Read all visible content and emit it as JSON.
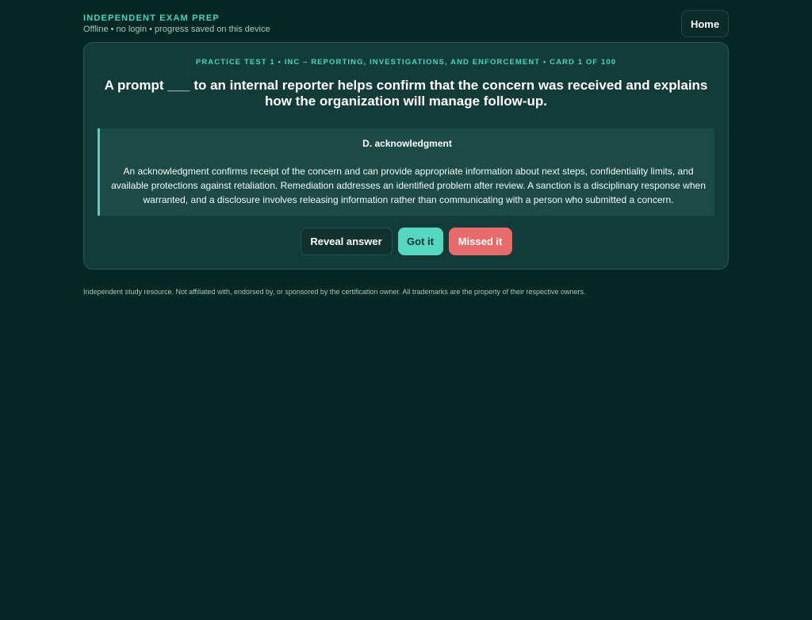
{
  "header": {
    "brand": "INDEPENDENT EXAM PREP",
    "tagline": "Offline • no login • progress saved on this device",
    "home_label": "Home"
  },
  "card": {
    "meta": "PRACTICE TEST 1 • INC – REPORTING, INVESTIGATIONS, AND ENFORCEMENT • CARD 1 OF 100",
    "question": "A prompt ___ to an internal reporter helps confirm that the concern was received and explains how the organization will manage follow-up.",
    "answer": {
      "label": "D. acknowledgment",
      "explanation": "An acknowledgment confirms receipt of the concern and can provide appropriate information about next steps, confidentiality limits, and available protections against retaliation. Remediation addresses an identified problem after review. A sanction is a disciplinary response when warranted, and a disclosure involves releasing information rather than communicating with a person who submitted a concern."
    },
    "actions": {
      "reveal_label": "Reveal answer",
      "got_label": "Got it",
      "missed_label": "Missed it"
    }
  },
  "footer": {
    "disclaimer": "Independent study resource. Not affiliated with, endorsed by, or sponsored by the certification owner. All trademarks are the property of their respective owners."
  },
  "colors": {
    "background": "#072725",
    "card": "#133b37",
    "accent": "#41d8bd",
    "success": "#55d7c2",
    "danger": "#e86b6c"
  }
}
